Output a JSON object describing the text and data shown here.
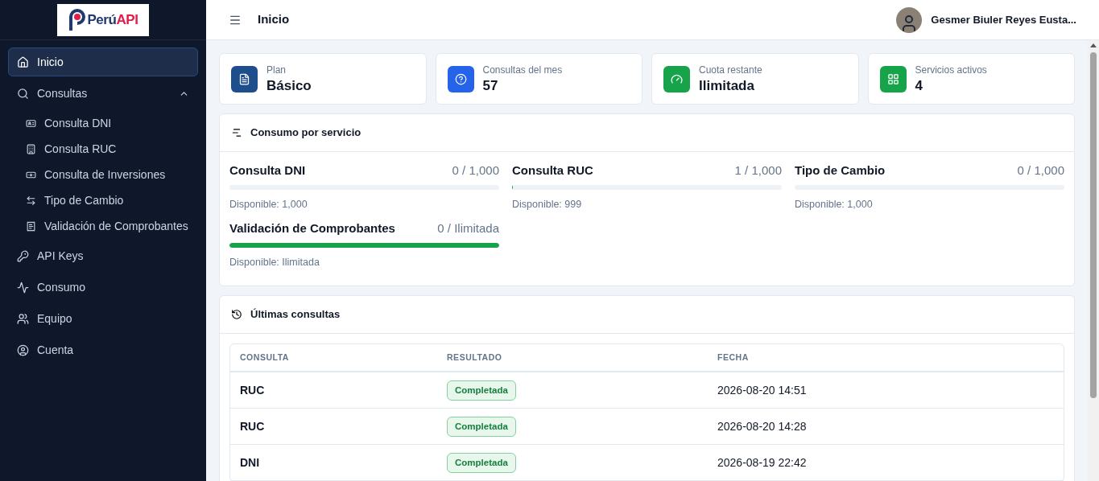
{
  "logo": {
    "part_1": "Perú",
    "part_2": "API"
  },
  "sidebar": {
    "items": [
      {
        "kind": "item",
        "label": "Inicio",
        "selected": true
      },
      {
        "kind": "group",
        "label": "Consultas",
        "selected": false,
        "expanded": true,
        "children": [
          {
            "label": "Consulta DNI",
            "selected": false
          },
          {
            "label": "Consulta RUC",
            "selected": false
          },
          {
            "label": "Consulta de Inversiones",
            "selected": false
          },
          {
            "label": "Tipo de Cambio",
            "selected": false
          },
          {
            "label": "Validación de Comprobantes",
            "selected": false
          }
        ]
      },
      {
        "kind": "item",
        "label": "API Keys",
        "selected": false
      },
      {
        "kind": "item",
        "label": "Consumo",
        "selected": false
      },
      {
        "kind": "item",
        "label": "Equipo",
        "selected": false
      },
      {
        "kind": "item",
        "label": "Cuenta",
        "selected": false
      }
    ]
  },
  "header": {
    "title": "Inicio",
    "user_name": "Gesmer Biuler Reyes Eusta..."
  },
  "stats": [
    {
      "color": "#1e4e8c",
      "label": "Plan",
      "value": "Básico"
    },
    {
      "color": "#2563eb",
      "label": "Consultas del mes",
      "value": "57"
    },
    {
      "color": "#16a34a",
      "label": "Cuota restante",
      "value": "Ilimitada"
    },
    {
      "color": "#16a34a",
      "label": "Servicios activos",
      "value": "4"
    }
  ],
  "usage": {
    "title": "Consumo por servicio",
    "services": [
      {
        "name": "Consulta DNI",
        "reading": "0 / 1,000",
        "level": 0,
        "available": "Disponible: 1,000"
      },
      {
        "name": "Consulta RUC",
        "reading": "1 / 1,000",
        "level": 0.001,
        "available": "Disponible: 999"
      },
      {
        "name": "Tipo de Cambio",
        "reading": "0 / 1,000",
        "level": 0,
        "available": "Disponible: 1,000"
      },
      {
        "name": "Validación de Comprobantes",
        "reading": "0 / Ilimitada",
        "level": 1,
        "available": "Disponible: Ilimitada"
      }
    ]
  },
  "recent": {
    "title": "Últimas consultas",
    "table": {
      "columns": [
        "CONSULTA",
        "RESULTADO",
        "FECHA"
      ],
      "rows": [
        {
          "consulta": "RUC",
          "resultado": "Completada",
          "fecha": "2026-08-20 14:51"
        },
        {
          "consulta": "RUC",
          "resultado": "Completada",
          "fecha": "2026-08-20 14:28"
        },
        {
          "consulta": "DNI",
          "resultado": "Completada",
          "fecha": "2026-08-19 22:42"
        }
      ]
    }
  }
}
